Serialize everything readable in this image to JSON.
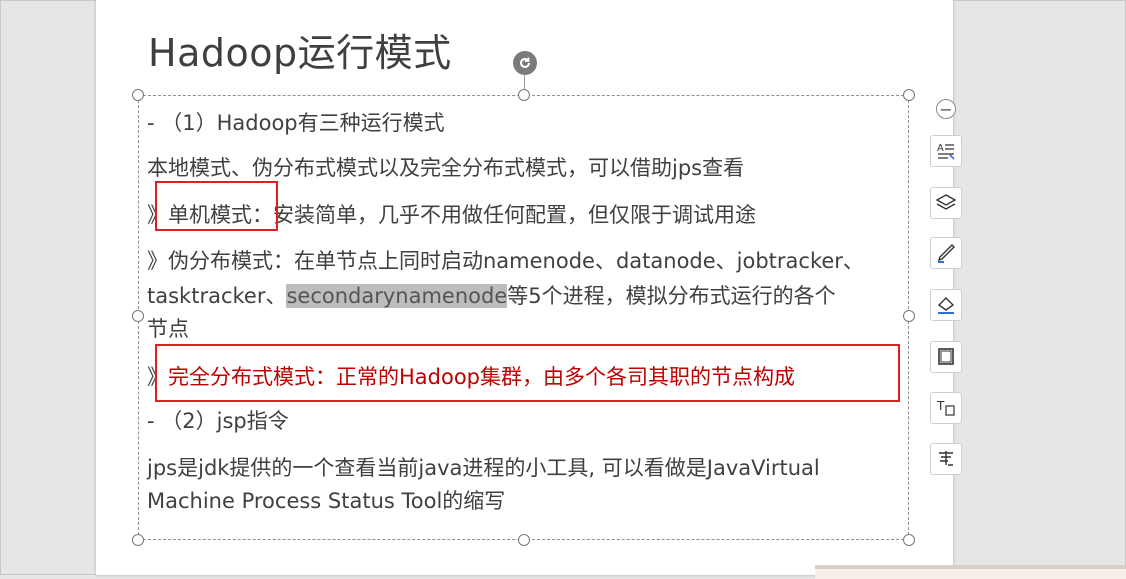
{
  "slide": {
    "title": "Hadoop运行模式",
    "lines": [
      "- （1）Hadoop有三种运行模式",
      "本地模式、伪分布式模式以及完全分布式模式，可以借助jps查看",
      "》单机模式：安装简单，几乎不用做任何配置，但仅限于调试用途",
      "》伪分布模式：在单节点上同时启动namenode、datanode、jobtracker、",
      "tasktracker、",
      "secondarynamenode",
      "等5个进程，模拟分布式运行的各个",
      "节点",
      "》",
      "完全分布式模式：正常的Hadoop集群，由多个各司其职的节点构成",
      "- （2）jsp指令",
      "jps是jdk提供的一个查看当前java进程的小工具, 可以看做是JavaVirtual",
      "Machine Process Status Tool的缩写"
    ]
  },
  "toolbar": {
    "minus": "−",
    "buttons": [
      "text-fill-icon",
      "layers-icon",
      "pen-icon",
      "shape-fill-icon",
      "border-icon",
      "text-box-icon",
      "text-spacing-icon"
    ]
  },
  "colors": {
    "accent_red": "#e02020",
    "text_red": "#c00000",
    "highlight": "#bdbdbd"
  }
}
